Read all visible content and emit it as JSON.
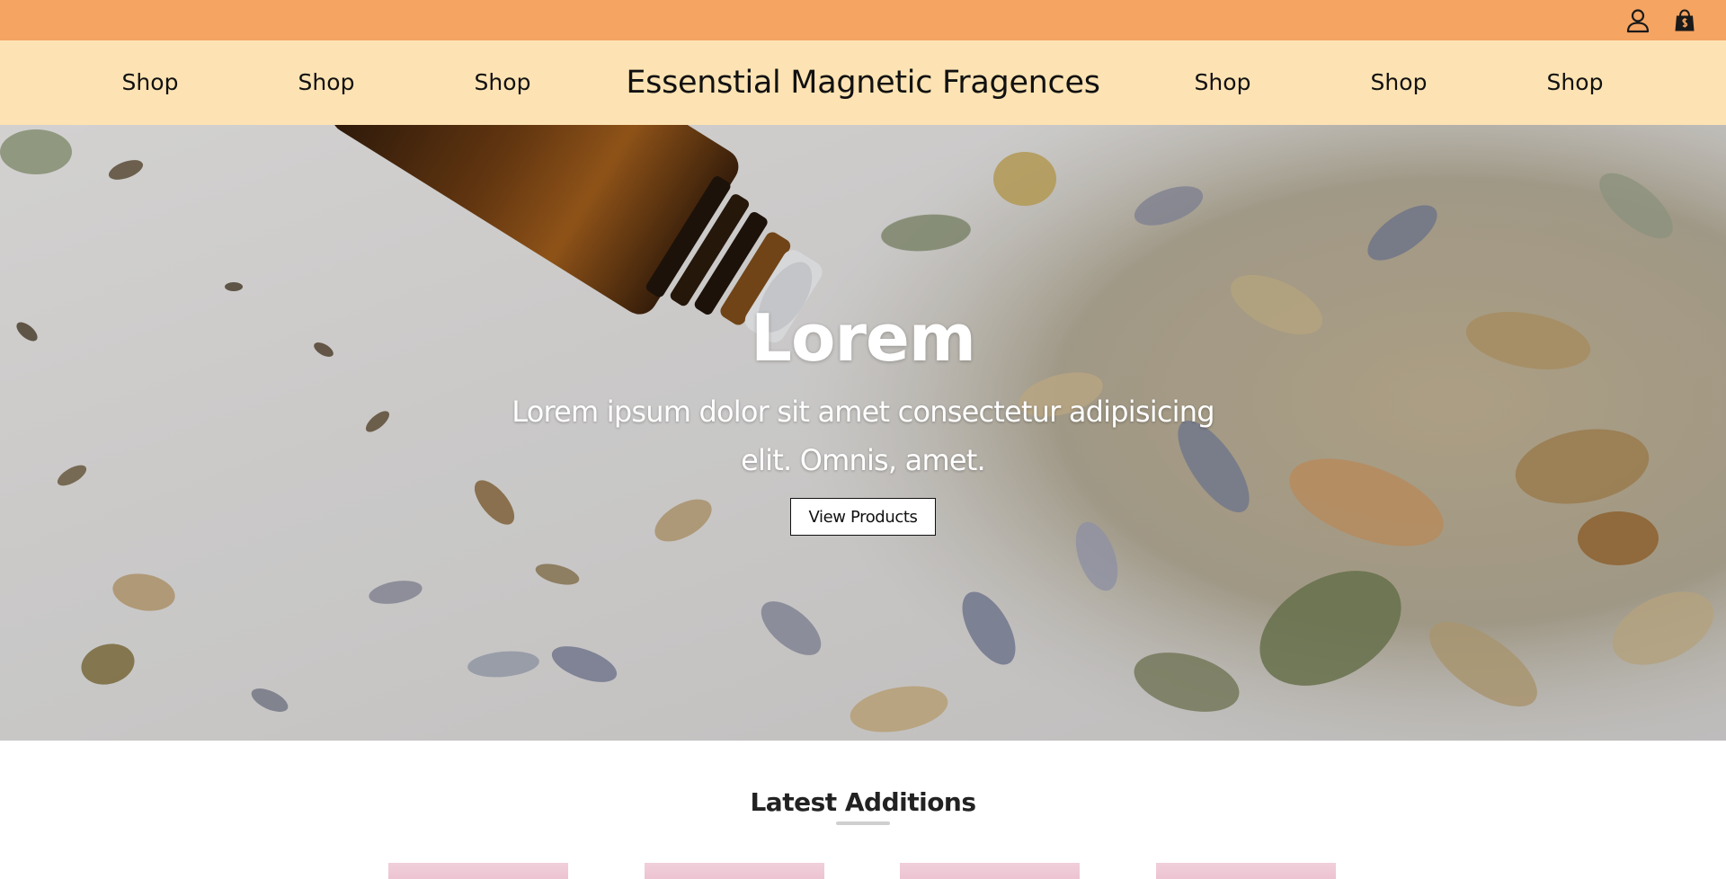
{
  "topbar": {
    "background": "#f5a462",
    "icons": [
      "user-icon",
      "shopping-bag-icon"
    ]
  },
  "nav": {
    "background": "#fde3b3",
    "brand": "Essenstial Magnetic Fragences",
    "links_left": [
      "Shop",
      "Shop",
      "Shop"
    ],
    "links_right": [
      "Shop",
      "Shop",
      "Shop"
    ]
  },
  "hero": {
    "title": "Lorem",
    "subtitle": "Lorem ipsum dolor sit amet consectetur adipisicing elit. Omnis, amet.",
    "button_label": "View Products"
  },
  "latest": {
    "title": "Latest Additions",
    "product_card_color": "#f1cfdb"
  }
}
